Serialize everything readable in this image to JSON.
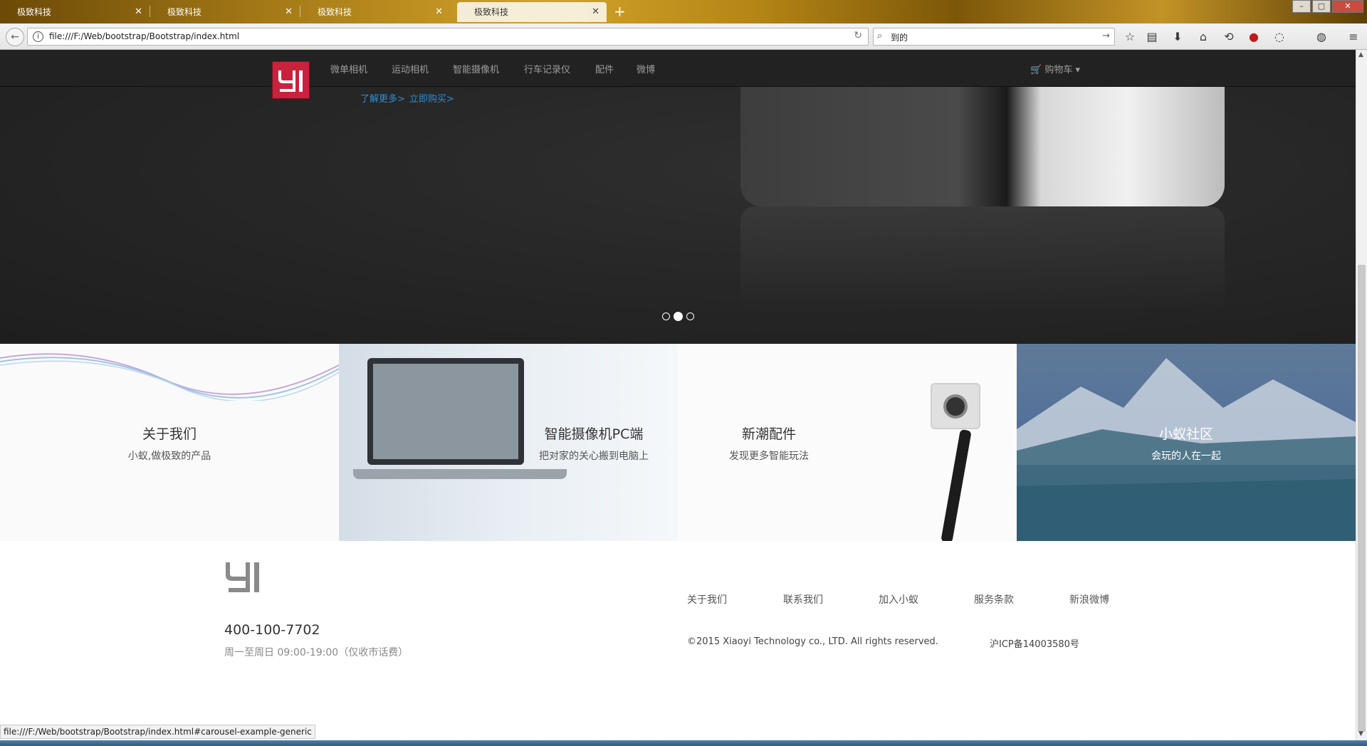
{
  "browser": {
    "tabs": [
      {
        "label": "极致科技",
        "active": false
      },
      {
        "label": "极致科技",
        "active": false
      },
      {
        "label": "极致科技",
        "active": false
      },
      {
        "label": "极致科技",
        "active": true
      }
    ],
    "url": "file:///F:/Web/bootstrap/Bootstrap/index.html",
    "search_value": "到的",
    "status_url": "file:///F:/Web/bootstrap/Bootstrap/index.html#carousel-example-generic",
    "icons": [
      "back-icon",
      "info-icon",
      "reload-icon",
      "search-icon",
      "star-icon",
      "reading-list-icon",
      "download-icon",
      "home-icon",
      "chat-icon",
      "addon-icon",
      "menu-icon"
    ]
  },
  "site": {
    "logo_text": "YI",
    "nav": [
      "微单相机",
      "运动相机",
      "智能摄像机",
      "行车记录仪",
      "配件",
      "微博"
    ],
    "cart": "购物车",
    "carousel": {
      "learn_more": "了解更多>",
      "buy_now": "立即购买>",
      "slide_count": 3,
      "active_slide": 2
    },
    "features": [
      {
        "title": "关于我们",
        "subtitle": "小蚁,做极致的产品"
      },
      {
        "title": "智能摄像机PC端",
        "subtitle": "把对家的关心搬到电脑上"
      },
      {
        "title": "新潮配件",
        "subtitle": "发现更多智能玩法"
      },
      {
        "title": "小蚁社区",
        "subtitle": "会玩的人在一起"
      }
    ],
    "footer": {
      "phone": "400-100-7702",
      "hours": "周一至周日 09:00-19:00（仅收市话费）",
      "links": [
        "关于我们",
        "联系我们",
        "加入小蚁",
        "服务条款",
        "新浪微博"
      ],
      "copyright": "©2015 Xiaoyi Technology co., LTD. All rights reserved.",
      "icp": "沪ICP备14003580号"
    }
  },
  "colors": {
    "brand_red": "#c9223d",
    "link_blue": "#2f8ccf",
    "nav_bg": "#222222"
  }
}
